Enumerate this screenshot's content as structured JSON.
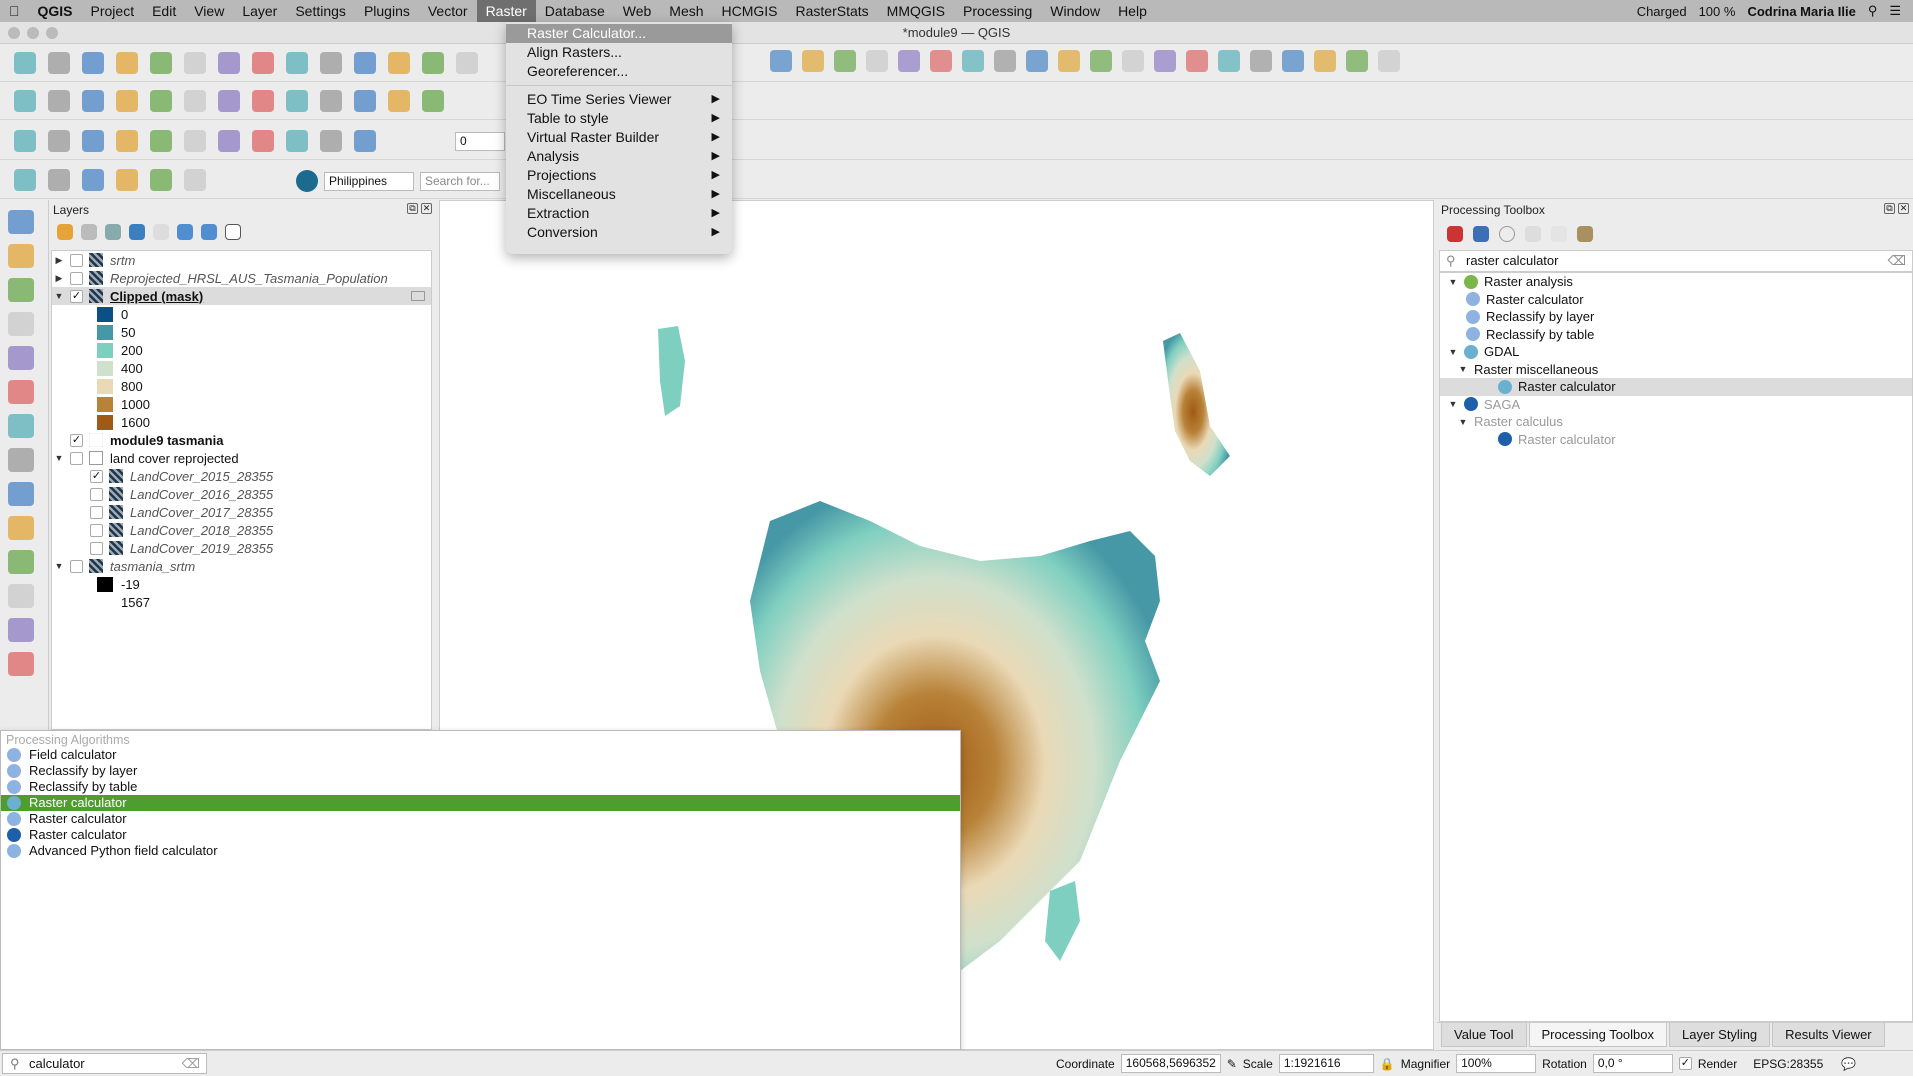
{
  "menubar": {
    "apple": "",
    "items": [
      "QGIS",
      "Project",
      "Edit",
      "View",
      "Layer",
      "Settings",
      "Plugins",
      "Vector",
      "Raster",
      "Database",
      "Web",
      "Mesh",
      "HCMGIS",
      "RasterStats",
      "MMQGIS",
      "Processing",
      "Window",
      "Help"
    ],
    "active": "Raster",
    "battery_status": "Charged",
    "battery_percent": "100 %",
    "user": "Codrina Maria Ilie"
  },
  "window": {
    "title": "*module9 — QGIS"
  },
  "raster_menu": {
    "items": [
      {
        "label": "Raster Calculator...",
        "highlighted": true
      },
      {
        "label": "Align Rasters..."
      },
      {
        "label": "Georeferencer..."
      }
    ],
    "submenus": [
      "EO Time Series Viewer",
      "Table to style",
      "Virtual Raster Builder",
      "Analysis",
      "Projections",
      "Miscellaneous",
      "Extraction",
      "Conversion"
    ]
  },
  "toolbar": {
    "snapping_tolerance": "0",
    "locator_country": "Philippines",
    "search_placeholder": "Search for...",
    "row1_icons": [
      "new-project",
      "open-project",
      "save-project",
      "print-layout",
      "layout-manager",
      "style-manager",
      "pan",
      "pan-to-selection",
      "zoom-in",
      "zoom-out",
      "zoom-full",
      "zoom-layer",
      "zoom-selection",
      "zoom-native"
    ],
    "row2_icons": [
      "digitize",
      "edit",
      "save-edits",
      "add-feature",
      "move-feature",
      "delete",
      "cut",
      "copy",
      "paste",
      "undo",
      "redo",
      "db-manager",
      "query-builder"
    ],
    "row3_icons": [
      "shape-digitize",
      "curve",
      "polygon",
      "point",
      "add-ring",
      "fill-ring",
      "delete-ring",
      "reshape",
      "split",
      "magnet",
      "vertex-tool"
    ],
    "row4_icons": [
      "select",
      "deselect",
      "select-by-expression",
      "open-attribute-table",
      "sticky-note",
      "python-locator"
    ],
    "right_icons": [
      "identify",
      "attribute-table",
      "field-stats",
      "processing",
      "sum",
      "measure",
      "map-tips",
      "annotations",
      "text-annotation",
      "python",
      "model",
      "gdal",
      "georef",
      "pdf",
      "ref-plugin",
      "grid",
      "layers",
      "lines",
      "heatmap",
      "qgis-cloud"
    ]
  },
  "left_toolbar": {
    "icons": [
      "add-vector-layer",
      "add-raster-layer",
      "add-mesh-layer",
      "add-delimited-text",
      "add-spatialite",
      "add-virtual-layer",
      "add-postgis",
      "add-wms",
      "add-wcs",
      "add-wfs",
      "add-arcgis",
      "processing-tool",
      "refresh",
      "crosshair"
    ]
  },
  "layers_panel": {
    "title": "Layers",
    "layers": [
      {
        "name": "srtm",
        "checked": false,
        "style": "italic",
        "expand": "collapsed"
      },
      {
        "name": "Reprojected_HRSL_AUS_Tasmania_Population",
        "checked": false,
        "style": "italic",
        "expand": "collapsed"
      },
      {
        "name": "Clipped (mask)",
        "checked": true,
        "style": "bold-underline",
        "expand": "expanded",
        "selected": true
      },
      {
        "legend": "0",
        "color": "#0b4f86"
      },
      {
        "legend": "50",
        "color": "#4698a6"
      },
      {
        "legend": "200",
        "color": "#7fcfc0"
      },
      {
        "legend": "400",
        "color": "#cfe0cc"
      },
      {
        "legend": "800",
        "color": "#ead9b6"
      },
      {
        "legend": "1000",
        "color": "#b88238"
      },
      {
        "legend": "1600",
        "color": "#a15a16"
      },
      {
        "name": "module9 tasmania",
        "checked": true,
        "style": "bold"
      },
      {
        "name": "land cover reprojected",
        "checked": false,
        "style": "group",
        "expand": "expanded"
      },
      {
        "name": "LandCover_2015_28355",
        "checked": true,
        "style": "italic",
        "indent": true
      },
      {
        "name": "LandCover_2016_28355",
        "checked": false,
        "style": "italic",
        "indent": true
      },
      {
        "name": "LandCover_2017_28355",
        "checked": false,
        "style": "italic",
        "indent": true
      },
      {
        "name": "LandCover_2018_28355",
        "checked": false,
        "style": "italic",
        "indent": true
      },
      {
        "name": "LandCover_2019_28355",
        "checked": false,
        "style": "italic",
        "indent": true
      },
      {
        "name": "tasmania_srtm",
        "checked": false,
        "style": "italic",
        "expand": "expanded"
      },
      {
        "legend": "-19",
        "color": "#000000"
      },
      {
        "legend": "1567",
        "color": ""
      }
    ]
  },
  "toolbox": {
    "title": "Processing Toolbox",
    "search_value": "raster calculator",
    "tree": [
      {
        "label": "Raster analysis",
        "level": 0,
        "icon": "qgis",
        "expand": true
      },
      {
        "label": "Raster calculator",
        "level": 1,
        "icon": "gear"
      },
      {
        "label": "Reclassify by layer",
        "level": 1,
        "icon": "gear"
      },
      {
        "label": "Reclassify by table",
        "level": 1,
        "icon": "gear"
      },
      {
        "label": "GDAL",
        "level": 0,
        "icon": "gdal",
        "expand": true
      },
      {
        "label": "Raster miscellaneous",
        "level": 1,
        "expand": true
      },
      {
        "label": "Raster calculator",
        "level": 2,
        "icon": "gdal",
        "selected": true
      },
      {
        "label": "SAGA",
        "level": 0,
        "icon": "saga",
        "expand": true,
        "dim": true
      },
      {
        "label": "Raster calculus",
        "level": 1,
        "expand": true,
        "dim": true
      },
      {
        "label": "Raster calculator",
        "level": 2,
        "icon": "saga",
        "dim": true
      }
    ]
  },
  "dock_tabs": [
    {
      "label": "Value Tool"
    },
    {
      "label": "Processing Toolbox",
      "active": true
    },
    {
      "label": "Layer Styling"
    },
    {
      "label": "Results Viewer"
    }
  ],
  "locator": {
    "header": "Processing Algorithms",
    "results": [
      {
        "label": "Field calculator",
        "icon": "gear"
      },
      {
        "label": "Reclassify by layer",
        "icon": "gear"
      },
      {
        "label": "Reclassify by table",
        "icon": "gear"
      },
      {
        "label": "Raster calculator",
        "icon": "gdal",
        "selected": true
      },
      {
        "label": "Raster calculator",
        "icon": "gear"
      },
      {
        "label": "Raster calculator",
        "icon": "saga"
      },
      {
        "label": "Advanced Python field calculator",
        "icon": "gear"
      }
    ],
    "search_value": "calculator"
  },
  "statusbar": {
    "coordinate_label": "Coordinate",
    "coordinate": "160568,5696352",
    "scale_label": "Scale",
    "scale": "1:1921616",
    "magnifier_label": "Magnifier",
    "magnifier": "100%",
    "rotation_label": "Rotation",
    "rotation": "0,0 °",
    "render_label": "Render",
    "render_checked": true,
    "crs": "EPSG:28355"
  },
  "colors": {
    "selection_green": "#4d9e2f",
    "menu_highlight": "#9a9a9a"
  }
}
